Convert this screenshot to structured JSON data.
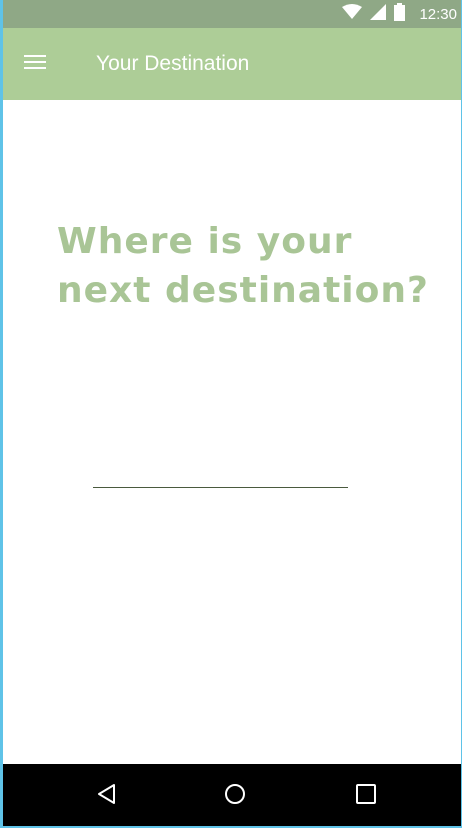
{
  "status_bar": {
    "time": "12:30",
    "icons": [
      "wifi-icon",
      "signal-icon",
      "battery-icon"
    ]
  },
  "app_bar": {
    "title": "Your Destination",
    "menu_icon": "hamburger-menu-icon"
  },
  "main": {
    "question_line1": "Where is your",
    "question_line2": "next destination?",
    "destination_input": {
      "value": "",
      "placeholder": ""
    }
  },
  "nav_bar": {
    "icons": [
      "back-icon",
      "home-icon",
      "recent-apps-icon"
    ]
  },
  "colors": {
    "status_bar": "#8fa886",
    "app_bar": "#adcd97",
    "question_text": "#a9c596",
    "nav_bar": "#000000"
  }
}
